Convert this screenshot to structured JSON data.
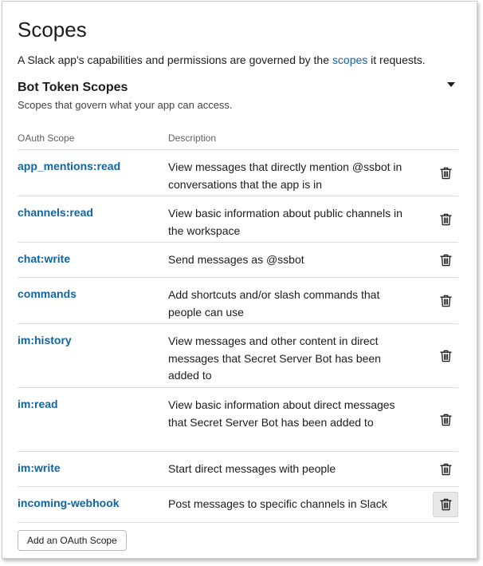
{
  "page": {
    "title": "Scopes",
    "intro_before": "A Slack app's capabilities and permissions are governed by the ",
    "intro_link": "scopes",
    "intro_after": " it requests."
  },
  "section": {
    "title": "Bot Token Scopes",
    "subtitle": "Scopes that govern what your app can access."
  },
  "table": {
    "headers": {
      "scope": "OAuth Scope",
      "description": "Description"
    },
    "rows": [
      {
        "scope": "app_mentions:read",
        "description": "View messages that directly mention @ssbot in conversations that the app is in"
      },
      {
        "scope": "channels:read",
        "description": "View basic information about public channels in the workspace"
      },
      {
        "scope": "chat:write",
        "description": "Send messages as @ssbot"
      },
      {
        "scope": "commands",
        "description": "Add shortcuts and/or slash commands that people can use"
      },
      {
        "scope": "im:history",
        "description": "View messages and other content in direct messages that Secret Server Bot has been added to"
      },
      {
        "scope": "im:read",
        "description": "View basic information about direct messages that Secret Server Bot has been added to"
      },
      {
        "scope": "im:write",
        "description": "Start direct messages with people"
      },
      {
        "scope": "incoming-webhook",
        "description": "Post messages to specific channels in Slack"
      }
    ]
  },
  "actions": {
    "add_scope": "Add an OAuth Scope"
  },
  "icons": {
    "delete": "trash-icon",
    "collapse": "caret-down-icon"
  },
  "colors": {
    "link": "#1264a3",
    "text": "#1d1c1d",
    "divider": "#dddddd"
  }
}
